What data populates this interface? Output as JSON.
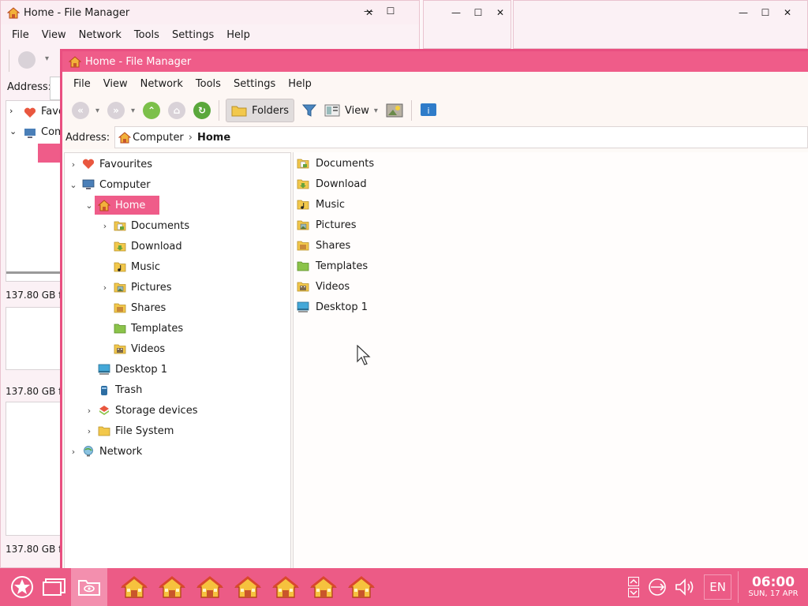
{
  "windows": {
    "background": {
      "title": "Home - File Manager",
      "menu": [
        "File",
        "View",
        "Network",
        "Tools",
        "Settings",
        "Help"
      ],
      "address_label": "Address:",
      "tree_peek": [
        "Favo",
        "Com"
      ],
      "status": [
        "137.80 GB f",
        "137.80 GB f",
        "137.80 GB f"
      ]
    },
    "main": {
      "title": "Home - File Manager",
      "menu": [
        "File",
        "View",
        "Network",
        "Tools",
        "Settings",
        "Help"
      ],
      "toolbar": {
        "folders_label": "Folders",
        "view_label": "View"
      },
      "address": {
        "label": "Address:",
        "crumbs": [
          "Computer",
          "Home"
        ]
      },
      "tree": [
        {
          "label": "Favourites",
          "expandable": true,
          "icon": "heart-icon"
        },
        {
          "label": "Computer",
          "expandable": true,
          "expanded": true,
          "icon": "computer-icon"
        },
        {
          "label": "Home",
          "expandable": true,
          "expanded": true,
          "selected": true,
          "icon": "home-icon"
        },
        {
          "label": "Documents",
          "expandable": true,
          "icon": "folder-documents-icon"
        },
        {
          "label": "Download",
          "expandable": false,
          "icon": "folder-download-icon"
        },
        {
          "label": "Music",
          "expandable": false,
          "icon": "folder-music-icon"
        },
        {
          "label": "Pictures",
          "expandable": true,
          "icon": "folder-pictures-icon"
        },
        {
          "label": "Shares",
          "expandable": false,
          "icon": "folder-shares-icon"
        },
        {
          "label": "Templates",
          "expandable": false,
          "icon": "folder-templates-icon"
        },
        {
          "label": "Videos",
          "expandable": false,
          "icon": "folder-videos-icon"
        },
        {
          "label": "Desktop 1",
          "expandable": false,
          "icon": "desktop-icon"
        },
        {
          "label": "Trash",
          "expandable": false,
          "icon": "trash-icon"
        },
        {
          "label": "Storage devices",
          "expandable": true,
          "icon": "storage-icon"
        },
        {
          "label": "File System",
          "expandable": true,
          "icon": "folder-icon"
        },
        {
          "label": "Network",
          "expandable": true,
          "icon": "network-globe-icon"
        }
      ],
      "files": [
        {
          "label": "Documents",
          "icon": "folder-documents-icon"
        },
        {
          "label": "Download",
          "icon": "folder-download-icon"
        },
        {
          "label": "Music",
          "icon": "folder-music-icon"
        },
        {
          "label": "Pictures",
          "icon": "folder-pictures-icon"
        },
        {
          "label": "Shares",
          "icon": "folder-shares-icon"
        },
        {
          "label": "Templates",
          "icon": "folder-templates-icon"
        },
        {
          "label": "Videos",
          "icon": "folder-videos-icon"
        },
        {
          "label": "Desktop 1",
          "icon": "desktop-icon"
        }
      ]
    }
  },
  "taskbar": {
    "language": "EN",
    "time": "06:00",
    "date": "SUN, 17 APR",
    "task_count": 7
  },
  "colors": {
    "accent": "#ef5c89",
    "taskbar": "#ec5b86",
    "folder": "#f2c84b"
  }
}
